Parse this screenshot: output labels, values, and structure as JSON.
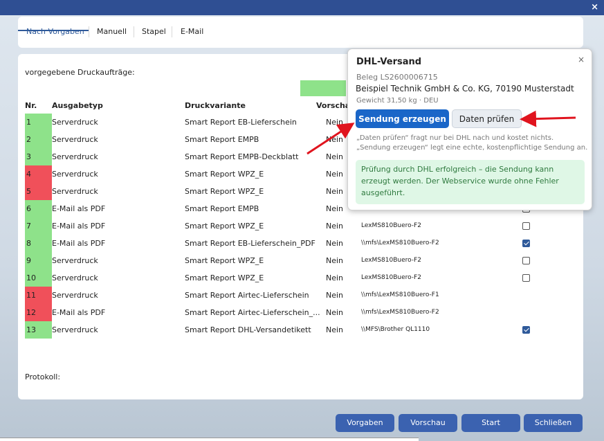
{
  "window": {
    "close_glyph": "×"
  },
  "tabs": [
    {
      "label": "Nach Vorgaben",
      "active": true
    },
    {
      "label": "Manuell"
    },
    {
      "label": "Stapel"
    },
    {
      "label": "E-Mail"
    }
  ],
  "main": {
    "label": "vorgegebene Druckaufträge:",
    "headers": {
      "nr": "Nr.",
      "ausgabetyp": "Ausgabetyp",
      "druckvariante": "Druckvariante",
      "vorschau": "Vorscha"
    },
    "rows": [
      {
        "nr": "1",
        "status": "green",
        "ausgabetyp": "Serverdruck",
        "druckvariante": "Smart Report EB-Lieferschein",
        "vorschau": "Nein",
        "drucker": "",
        "checked": null
      },
      {
        "nr": "2",
        "status": "green",
        "ausgabetyp": "Serverdruck",
        "druckvariante": "Smart Report EMPB",
        "vorschau": "Nein",
        "drucker": "",
        "checked": null
      },
      {
        "nr": "3",
        "status": "green",
        "ausgabetyp": "Serverdruck",
        "druckvariante": "Smart Report EMPB-Deckblatt",
        "vorschau": "Nein",
        "drucker": "",
        "checked": null
      },
      {
        "nr": "4",
        "status": "red",
        "ausgabetyp": "Serverdruck",
        "druckvariante": "Smart Report WPZ_E",
        "vorschau": "Nein",
        "drucker": "",
        "checked": null
      },
      {
        "nr": "5",
        "status": "red",
        "ausgabetyp": "Serverdruck",
        "druckvariante": "Smart Report WPZ_E",
        "vorschau": "Nein",
        "drucker": "",
        "checked": null
      },
      {
        "nr": "6",
        "status": "green",
        "ausgabetyp": "E-Mail als PDF",
        "druckvariante": "Smart Report EMPB",
        "vorschau": "Nein",
        "drucker": "",
        "checked": false
      },
      {
        "nr": "7",
        "status": "green",
        "ausgabetyp": "E-Mail als PDF",
        "druckvariante": "Smart Report WPZ_E",
        "vorschau": "Nein",
        "drucker": "LexMS810Buero-F2",
        "checked": false
      },
      {
        "nr": "8",
        "status": "green",
        "ausgabetyp": "E-Mail als PDF",
        "druckvariante": "Smart Report EB-Lieferschein_PDF",
        "vorschau": "Nein",
        "drucker": "\\\\mfs\\LexMS810Buero-F2",
        "checked": true
      },
      {
        "nr": "9",
        "status": "green",
        "ausgabetyp": "Serverdruck",
        "druckvariante": "Smart Report WPZ_E",
        "vorschau": "Nein",
        "drucker": "LexMS810Buero-F2",
        "checked": false
      },
      {
        "nr": "10",
        "status": "green",
        "ausgabetyp": "Serverdruck",
        "druckvariante": "Smart Report WPZ_E",
        "vorschau": "Nein",
        "drucker": "LexMS810Buero-F2",
        "checked": false
      },
      {
        "nr": "11",
        "status": "red",
        "ausgabetyp": "Serverdruck",
        "druckvariante": "Smart Report Airtec-Lieferschein",
        "vorschau": "Nein",
        "drucker": "\\\\mfs\\LexMS810Buero-F1",
        "checked": null
      },
      {
        "nr": "12",
        "status": "red",
        "ausgabetyp": "E-Mail als PDF",
        "druckvariante": "Smart Report Airtec-Lieferschein_...",
        "vorschau": "Nein",
        "drucker": "\\\\mfs\\LexMS810Buero-F2",
        "checked": null
      },
      {
        "nr": "13",
        "status": "green",
        "ausgabetyp": "Serverdruck",
        "druckvariante": "Smart Report DHL-Versandetikett",
        "vorschau": "Nein",
        "drucker": "\\\\MFS\\Brother QL1110",
        "checked": true
      }
    ],
    "protokoll_label": "Protokoll:"
  },
  "buttons": {
    "vorgaben": "Vorgaben",
    "vorschau": "Vorschau",
    "start": "Start",
    "schliessen": "Schließen"
  },
  "popup": {
    "title": "DHL-Versand",
    "close_glyph": "×",
    "beleg": "Beleg LS2600006715",
    "company": "Beispiel Technik GmbH & Co. KG, 70190 Musterstadt",
    "weight": "Gewicht 31,50 kg · DEU",
    "create_label": "Sendung erzeugen",
    "check_label": "Daten prüfen",
    "hint": "„Daten prüfen“ fragt nur bei DHL nach und kostet nichts. „Sendung erzeugen“ legt eine echte, kostenpflichtige Sendung an.",
    "success": "Prüfung durch DHL erfolgreich – die Sendung kann erzeugt werden. Der Webservice wurde ohne Fehler ausgeführt."
  },
  "colors": {
    "accent": "#1a66c8",
    "ok": "#8ee28a",
    "error": "#f0505a",
    "arrow": "#e0141e"
  }
}
